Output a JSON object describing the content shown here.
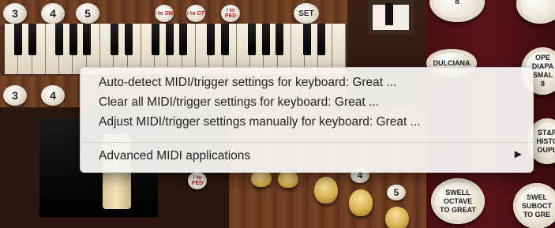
{
  "background": {
    "top_pistons": [
      "3",
      "4",
      "5"
    ],
    "top_small_pistons": [
      "I to SW",
      "I to GT",
      "I to PED"
    ],
    "set_label": "SET",
    "lower_pistons": [
      "3",
      "4"
    ],
    "lower_small_piston": "I to PED",
    "lower_number_pistons": [
      "4",
      "5"
    ],
    "right_stops": [
      {
        "label": "8"
      },
      {
        "label": "DULCIANA"
      },
      {
        "label": "OPE\nDIAPA\nSMAL\n8"
      },
      {
        "label": "ST&P\nHISTO\nOUPL"
      },
      {
        "label": "SWELL\nOCTAVE\nTO GREAT"
      },
      {
        "label": "SWEL\nSUBOCT\nTO GRE"
      }
    ]
  },
  "menu": {
    "items": [
      {
        "label": "Auto-detect MIDI/trigger settings for keyboard: Great ..."
      },
      {
        "label": "Clear all MIDI/trigger settings for keyboard: Great ..."
      },
      {
        "label": "Adjust MIDI/trigger settings manually for keyboard: Great ..."
      }
    ],
    "submenu": {
      "label": "Advanced MIDI applications",
      "arrow": "▶"
    }
  }
}
